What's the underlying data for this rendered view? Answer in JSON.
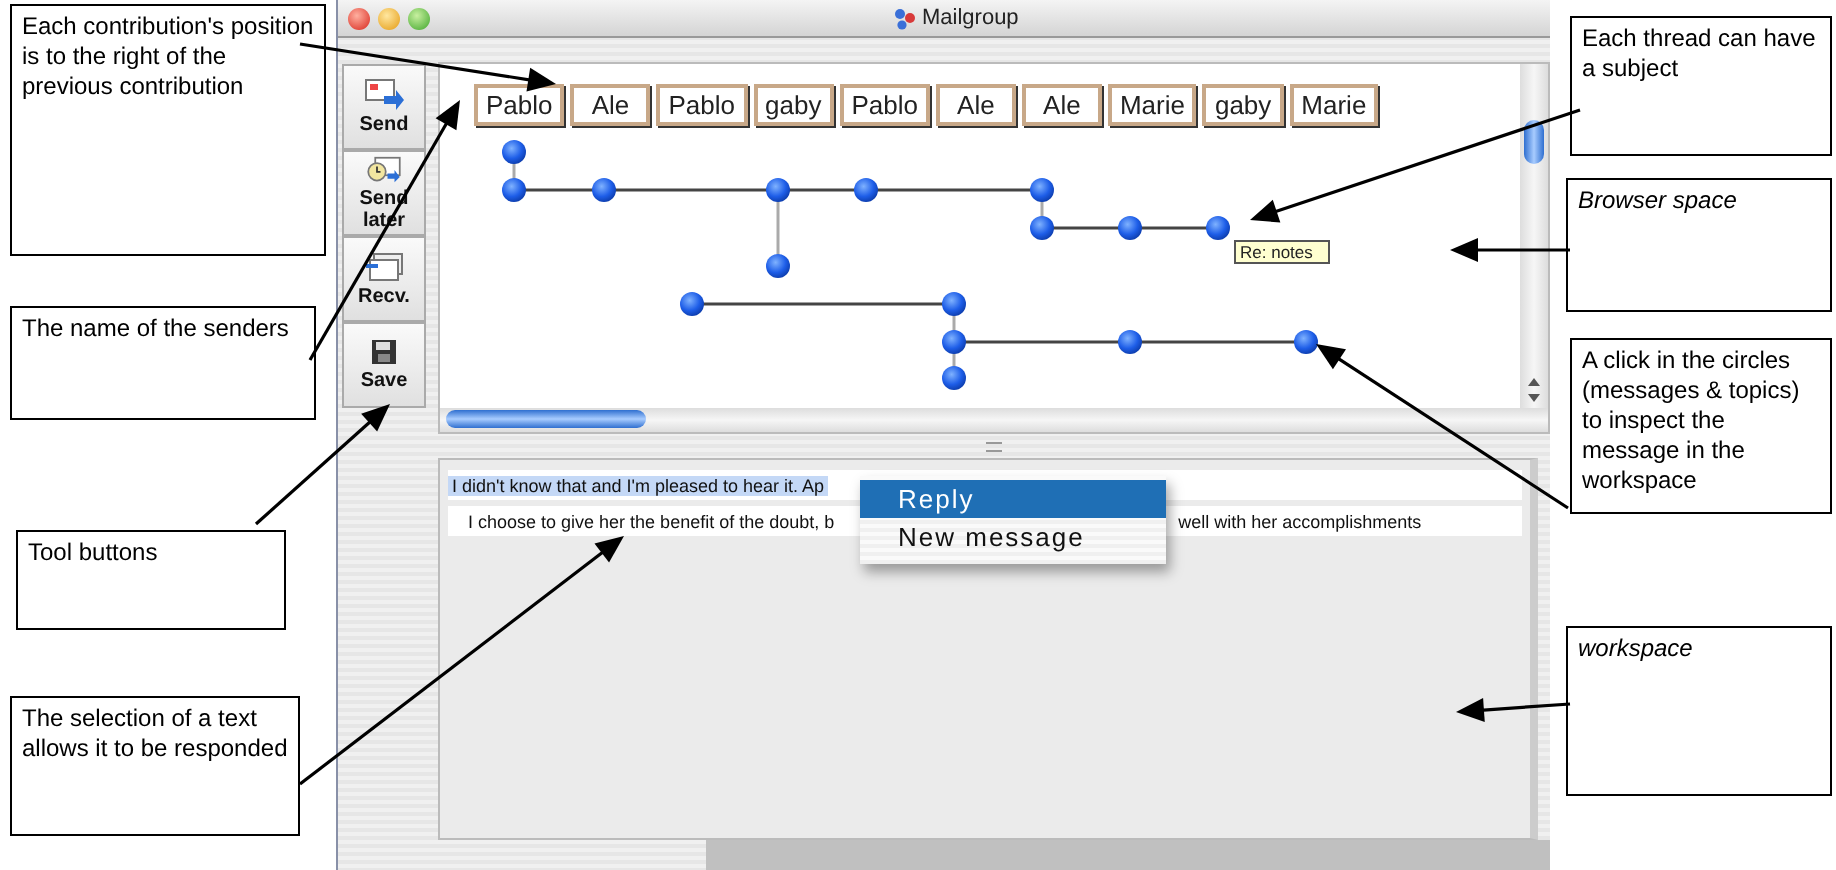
{
  "window": {
    "title": "Mailgroup"
  },
  "toolbar": [
    {
      "kind": "send",
      "label": "Send"
    },
    {
      "kind": "later",
      "label": "Send later"
    },
    {
      "kind": "receive",
      "label": "Recv."
    },
    {
      "kind": "save",
      "label": "Save"
    }
  ],
  "senders": [
    "Pablo",
    "Ale",
    "Pablo",
    "gaby",
    "Pablo",
    "Ale",
    "Ale",
    "Marie",
    "gaby",
    "Marie"
  ],
  "thread_subject": "Re: notes",
  "messages": [
    {
      "text": "I didn't know that and I'm pleased to hear it. Ap",
      "selected": true
    },
    {
      "text": "I choose to give her the benefit of the doubt, b",
      "text_after": "well with her accomplishments",
      "selected": false
    }
  ],
  "context_menu": [
    {
      "label": "Reply",
      "selected": true
    },
    {
      "label": "New message",
      "selected": false
    }
  ],
  "callouts": [
    {
      "text": "Each contribution's position is to the right of the previous contribution",
      "italic": false
    },
    {
      "text": "The name of the senders",
      "italic": false
    },
    {
      "text": "Tool buttons",
      "italic": false
    },
    {
      "text": "The selection of a text allows it to be responded",
      "italic": false
    },
    {
      "text": "Each thread can have a subject",
      "italic": false
    },
    {
      "text": "Browser space",
      "italic": true
    },
    {
      "text": "A click in the circles (messages & topics) to inspect the message in the workspace",
      "italic": false
    },
    {
      "text": "workspace",
      "italic": true
    }
  ]
}
